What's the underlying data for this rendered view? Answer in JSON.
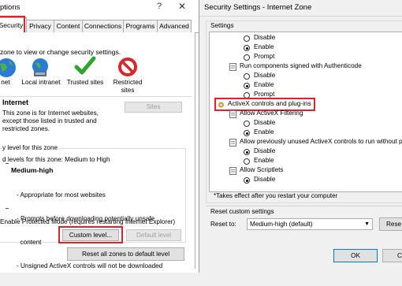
{
  "left": {
    "title": "ptions",
    "help": "?",
    "close": "✕",
    "tabs": [
      "Security",
      "Privacy",
      "Content",
      "Connections",
      "Programs",
      "Advanced"
    ],
    "intro": "zone to view or change security settings.",
    "zones": [
      {
        "label": "net",
        "icon": "globe-icon"
      },
      {
        "label": "Local intranet",
        "icon": "intranet-icon"
      },
      {
        "label": "Trusted sites",
        "icon": "check-icon"
      },
      {
        "label": "Restricted\nsites",
        "icon": "restricted-icon"
      }
    ],
    "zone_heading": "Internet",
    "zone_desc": [
      "This zone is for Internet websites,",
      "except those listed in trusted and",
      "restricted zones."
    ],
    "sites_button": "Sites",
    "level_group": "y level for this zone",
    "allowed_levels": "d levels for this zone: Medium to High",
    "level_name": "Medium-high",
    "level_bullets": [
      "- Appropriate for most websites",
      "- Prompts before downloading potentially unsafe",
      "  content",
      "- Unsigned ActiveX controls will not be downloaded"
    ],
    "protected_mode": "Enable Protected Mode (requires restarting Internet Explorer)",
    "custom_level": "Custom level...",
    "default_level": "Default level",
    "reset_all": "Reset all zones to default level"
  },
  "right": {
    "title": "Security Settings - Internet Zone",
    "settings_label": "Settings",
    "tree": [
      {
        "kind": "radio",
        "label": "Disable",
        "on": false
      },
      {
        "kind": "radio",
        "label": "Enable",
        "on": true
      },
      {
        "kind": "radio",
        "label": "Prompt",
        "on": false
      },
      {
        "kind": "node",
        "label": "Run components signed with Authenticode",
        "icon": "settings-node-icon"
      },
      {
        "kind": "radio",
        "label": "Disable",
        "on": false
      },
      {
        "kind": "radio",
        "label": "Enable",
        "on": true
      },
      {
        "kind": "radio",
        "label": "Prompt",
        "on": false
      },
      {
        "kind": "category",
        "label": "ActiveX controls and plug-ins",
        "icon": "gear-icon"
      },
      {
        "kind": "node",
        "label": "Allow ActiveX Filtering",
        "icon": "settings-node-icon"
      },
      {
        "kind": "radio",
        "label": "Disable",
        "on": false
      },
      {
        "kind": "radio",
        "label": "Enable",
        "on": true
      },
      {
        "kind": "node",
        "label": "Allow previously unused ActiveX controls to run without pr",
        "icon": "settings-node-icon"
      },
      {
        "kind": "radio",
        "label": "Disable",
        "on": true
      },
      {
        "kind": "radio",
        "label": "Enable",
        "on": false
      },
      {
        "kind": "node",
        "label": "Allow Scriptlets",
        "icon": "settings-node-icon"
      },
      {
        "kind": "radio",
        "label": "Disable",
        "on": true
      }
    ],
    "note": "*Takes effect after you restart your computer",
    "reset_group": "Reset custom settings",
    "reset_to": "Reset to:",
    "reset_value": "Medium-high (default)",
    "reset_button": "Rese",
    "ok": "OK",
    "cancel": "C"
  }
}
